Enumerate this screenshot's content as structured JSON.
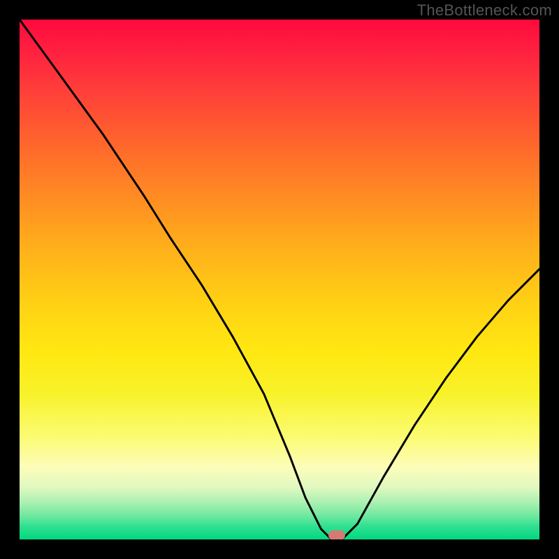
{
  "watermark": "TheBottleneck.com",
  "chart_data": {
    "type": "line",
    "title": "",
    "xlabel": "",
    "ylabel": "",
    "xlim": [
      0,
      100
    ],
    "ylim": [
      0,
      100
    ],
    "grid": false,
    "legend": false,
    "background": "red-yellow-green vertical gradient",
    "series": [
      {
        "name": "bottleneck-curve",
        "x": [
          0,
          8,
          16,
          24,
          29,
          35,
          41,
          47,
          52,
          55,
          58,
          60,
          62,
          65,
          70,
          76,
          82,
          88,
          94,
          100
        ],
        "y": [
          100,
          89,
          78,
          66,
          58,
          49,
          39,
          28,
          16,
          8,
          2,
          0,
          0,
          3,
          12,
          22,
          31,
          39,
          46,
          52
        ]
      }
    ],
    "marker": {
      "x": 61,
      "y": 0,
      "color": "#d57a72"
    }
  },
  "colors": {
    "frame": "#000000",
    "curve": "#000000",
    "marker": "#d57a72"
  }
}
